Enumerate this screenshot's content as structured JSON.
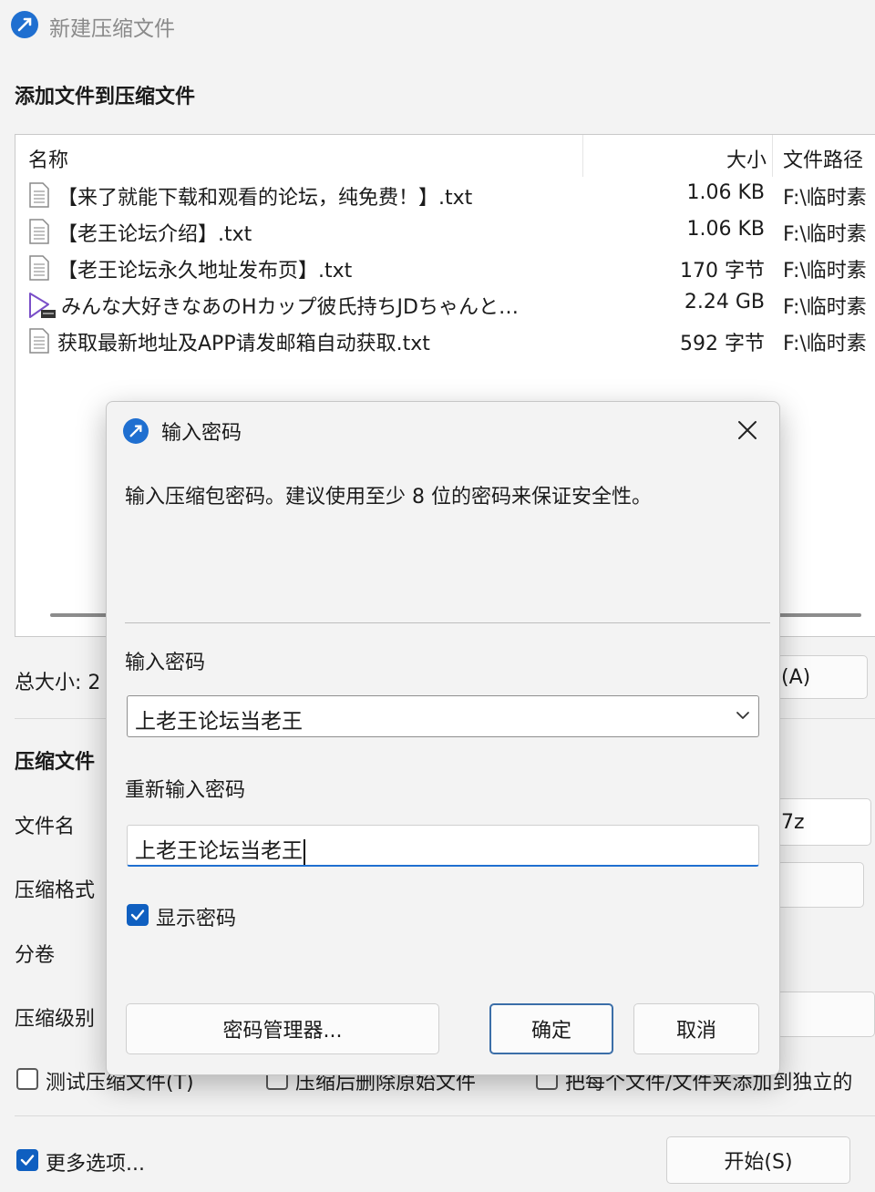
{
  "window": {
    "title": "新建压缩文件",
    "section_title": "添加文件到压缩文件"
  },
  "file_list": {
    "columns": {
      "name": "名称",
      "size": "大小",
      "path": "文件路径"
    },
    "rows": [
      {
        "name": "【来了就能下载和观看的论坛，纯免费！】.txt",
        "size": "1.06 KB",
        "path": "F:\\临时素",
        "icon": "text-file-icon"
      },
      {
        "name": "【老王论坛介绍】.txt",
        "size": "1.06 KB",
        "path": "F:\\临时素",
        "icon": "text-file-icon"
      },
      {
        "name": "【老王论坛永久地址发布页】.txt",
        "size": "170 字节",
        "path": "F:\\临时素",
        "icon": "text-file-icon"
      },
      {
        "name": "みんな大好きなあのHカップ彼氏持ちJDちゃんと…",
        "size": "2.24 GB",
        "path": "F:\\临时素",
        "icon": "video-file-icon"
      },
      {
        "name": "获取最新地址及APP请发邮箱自动获取.txt",
        "size": "592 字节",
        "path": "F:\\临时素",
        "icon": "text-file-icon"
      }
    ]
  },
  "summary": {
    "total_size_label": "总大小: 2",
    "add_button_label": "(A)"
  },
  "archive": {
    "section_label": "压缩文件",
    "filename_label": "文件名",
    "filename_value_partial": "7z",
    "format_label": "压缩格式",
    "split_label": "分卷",
    "level_label": "压缩级别"
  },
  "options": {
    "test_archive": "测试压缩文件(T)",
    "delete_after": "压缩后删除原始文件",
    "separate_archives": "把每个文件/文件夹添加到独立的",
    "more_options": "更多选项..."
  },
  "start_button": "开始(S)",
  "dialog": {
    "title": "输入密码",
    "description": "输入压缩包密码。建议使用至少 8 位的密码来保证安全性。",
    "password_label": "输入密码",
    "password_value": "上老王论坛当老王",
    "confirm_label": "重新输入密码",
    "confirm_value": "上老王论坛当老王",
    "show_password": "显示密码",
    "show_password_checked": true,
    "manager_button": "密码管理器...",
    "ok_button": "确定",
    "cancel_button": "取消"
  },
  "colors": {
    "accent": "#1f6fd0",
    "checkbox_checked": "#0f5fc0"
  }
}
